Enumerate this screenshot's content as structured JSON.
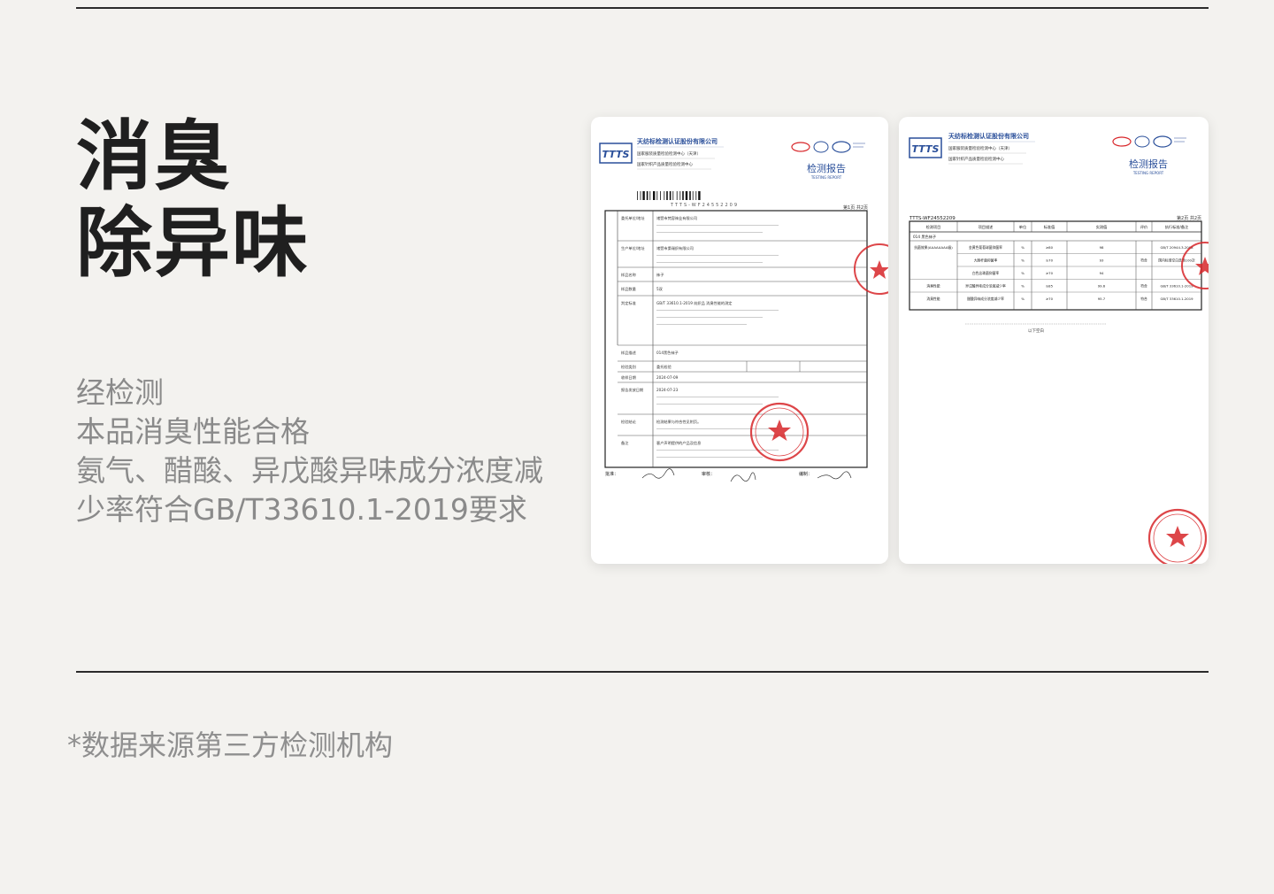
{
  "headline": {
    "line1": "消臭",
    "line2": "除异味"
  },
  "description": {
    "line1": "经检测",
    "line2": "本品消臭性能合格",
    "line3": "氨气、醋酸、异戊酸异味成分浓度减",
    "line4": "少率符合GB/T33610.1-2019要求"
  },
  "footnote": "*数据来源第三方检测机构",
  "reports": [
    {
      "org_name": "天纺标检测认证股份有限公司",
      "org_logo_text": "TTTS",
      "center1": "国家服装质量检验检测中心（天津）",
      "center2": "国家针织产品质量检验检测中心",
      "title": "检测报告",
      "title_en": "TESTING REPORT",
      "report_no": "TTTS-WF24552209",
      "page": "第1页 共2页",
      "rows": [
        [
          "委托单位/地址",
          "诸暨市梵容袜业有限公司"
        ],
        [
          "生产单位/地址",
          "诸暨市桑瑞织有限公司"
        ],
        [
          "样品名称",
          "袜子"
        ],
        [
          "样品数量",
          "5双"
        ],
        [
          "判定标准",
          "GB/T 33610.1-2019 纺织品 消臭性能的测定"
        ],
        [
          "样品描述",
          "014黑色袜子"
        ],
        [
          "检验类别",
          "委托检验"
        ],
        [
          "收样日期",
          "2024-07-09"
        ],
        [
          "报告发放日期",
          "2024-07-23"
        ],
        [
          "检验结论",
          "检测结果与符合性见附页。"
        ],
        [
          "备注",
          "客户声明提供的产品及信息"
        ]
      ],
      "signatures": [
        "批准：",
        "审核：",
        "编制："
      ]
    },
    {
      "org_name": "天纺标检测认证股份有限公司",
      "org_logo_text": "TTTS",
      "center1": "国家服装质量检验检测中心（天津）",
      "center2": "国家针织产品质量检验检测中心",
      "title": "检测报告",
      "title_en": "TESTING REPORT",
      "report_no": "TTTS-WF24552209",
      "page": "第2页 共2页",
      "headers": [
        "检测项目",
        "项目描述",
        "单位",
        "标准值",
        "实测值",
        "评价",
        "执行标准/备注"
      ],
      "sample": "014  黑色袜子",
      "results": [
        [
          "抗菌效果(AAAAAAAA级)",
          "金黄色葡萄球菌抑菌率",
          "%",
          "≥80",
          "98",
          "",
          "GB/T 20944.3-2008"
        ],
        [
          "",
          "大肠杆菌抑菌率",
          "%",
          "≥70",
          "93",
          "符合",
          "国内标准空白洗涤100次"
        ],
        [
          "",
          "白色念珠菌抑菌率",
          "%",
          "≥70",
          "94",
          "",
          ""
        ],
        [
          "消臭性能",
          "异戊酸异味成分浓度减少率",
          "%",
          "≥85",
          "99.6",
          "符合",
          "GB/T 33610.1-2019"
        ],
        [
          "消臭性能",
          "醋酸异味成分浓度减少率",
          "%",
          "≥70",
          "95.7",
          "符合",
          "GB/T 33610.1-2019"
        ]
      ],
      "end_note": "以下空白"
    }
  ],
  "colors": {
    "stamp": "#d8262a",
    "logo_blue": "#2a4f9a",
    "heading": "#1f1f1f",
    "muted": "#8a8a8a"
  }
}
